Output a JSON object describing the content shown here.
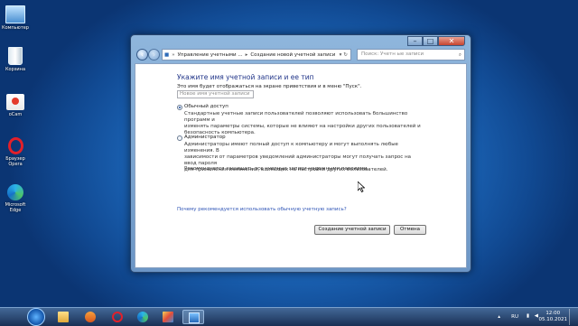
{
  "desktop": {
    "icons": [
      {
        "label": "Компьютер",
        "icon": "computer-icon"
      },
      {
        "label": "Корзина",
        "icon": "recycle-bin-icon"
      },
      {
        "label": "oCam",
        "icon": "ocam-icon"
      },
      {
        "label": "Браузер Opera",
        "icon": "opera-icon"
      },
      {
        "label": "Microsoft Edge",
        "icon": "edge-icon"
      }
    ]
  },
  "window": {
    "breadcrumbs": [
      "Управление учетными ...",
      "Создание новой учетной записи"
    ],
    "search_placeholder": "Поиск: Учетн ые записи",
    "heading": "Укажите имя учетной записи и ее тип",
    "hint": "Это имя будет отображаться на экране приветствия и в меню \"Пуск\".",
    "name_placeholder": "Новое имя учетной записи",
    "options": [
      {
        "label": "Обычный доступ",
        "selected": true,
        "description": [
          "Стандартные учетные записи пользователей позволяют использовать большинство программ и",
          "изменять параметры системы, которые не влияют на настройки других пользователей и",
          "безопасность компьютера."
        ]
      },
      {
        "label": "Администратор",
        "selected": false,
        "description": [
          "Администраторы имеют полный доступ к компьютеру и могут выполнять любые изменения. В",
          "зависимости от параметров уведомлений администраторы могут получать запрос на ввод пароля",
          "для применения изменений, влияющих на настройки других пользователей."
        ],
        "note": "Рекомендуется защищать все учетные записи надежными паролями."
      }
    ],
    "link": "Почему рекомендуется использовать обычную учетную запись?",
    "create_button": "Создание учетной записи",
    "cancel_button": "Отмена"
  },
  "taskbar": {
    "pinned": [
      "explorer-icon",
      "media-player-icon",
      "opera-icon",
      "edge-icon",
      "paint-icon",
      "control-panel-icon"
    ],
    "language": "RU",
    "time": "12:00",
    "date": "05.10.2021"
  }
}
